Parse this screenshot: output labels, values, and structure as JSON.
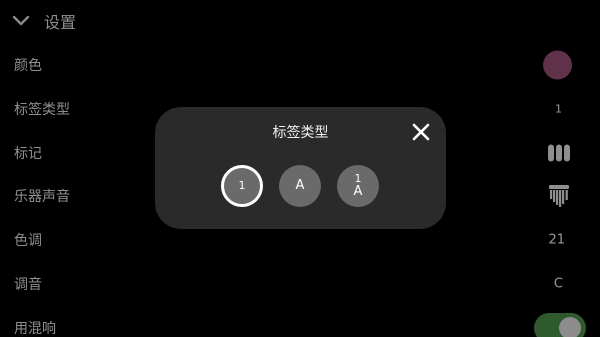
{
  "header": {
    "title": "设置",
    "icon": "chevron-down-icon"
  },
  "settings": {
    "color": {
      "label": "颜色",
      "swatch": "#5f3249"
    },
    "label_type": {
      "label": "标签类型",
      "value": "1"
    },
    "marker": {
      "label": "标记",
      "icon": "marker-bars-icon"
    },
    "instrument_sound": {
      "label": "乐器声音",
      "icon": "kalimba-icon"
    },
    "key": {
      "label": "色调",
      "value": "21"
    },
    "tuning": {
      "label": "调音",
      "value": "C"
    },
    "reverb": {
      "label": "用混响",
      "enabled": true
    }
  },
  "dialog": {
    "title": "标签类型",
    "close_icon": "close-icon",
    "options": [
      {
        "id": "number",
        "line1": "1",
        "line2": "",
        "selected": true
      },
      {
        "id": "letter",
        "line1": "",
        "line2": "A",
        "selected": false
      },
      {
        "id": "number-letter",
        "line1": "1",
        "line2": "A",
        "selected": false
      }
    ]
  },
  "colors": {
    "background": "#000000",
    "dialog": "#2a2a2a",
    "option": "#6a6a6a",
    "toggle_on": "#2f5a2d",
    "label_text": "#8f8f8f"
  }
}
